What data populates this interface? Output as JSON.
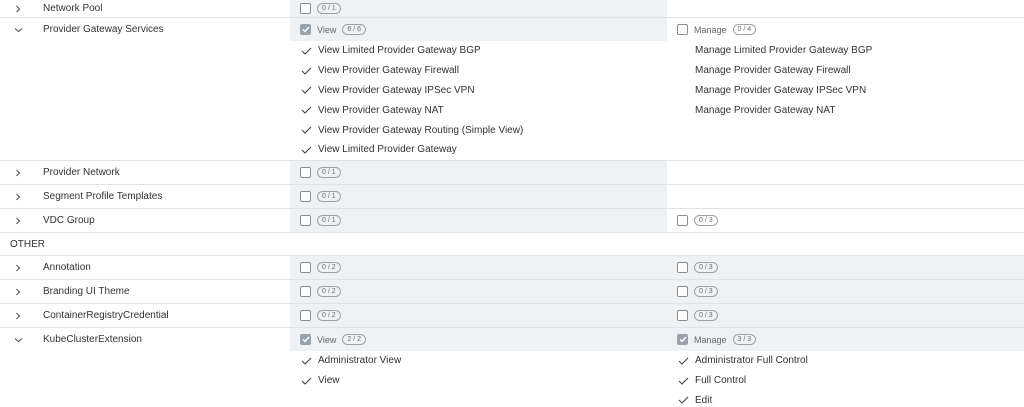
{
  "rows_top": [
    {
      "name": "Network Pool",
      "view_badge": "0 / 1"
    },
    {
      "name": "Provider Gateway Services",
      "view_label": "View",
      "view_badge": "6 / 6",
      "manage_label": "Manage",
      "manage_badge": "0 / 4",
      "view_perms": [
        "View Limited Provider Gateway BGP",
        "View Provider Gateway Firewall",
        "View Provider Gateway IPSec VPN",
        "View Provider Gateway NAT",
        "View Provider Gateway Routing (Simple View)",
        "View Limited Provider Gateway"
      ],
      "manage_perms": [
        "Manage Limited Provider Gateway BGP",
        "Manage Provider Gateway Firewall",
        "Manage Provider Gateway IPSec VPN",
        "Manage Provider Gateway NAT"
      ]
    },
    {
      "name": "Provider Network",
      "view_badge": "0 / 1"
    },
    {
      "name": "Segment Profile Templates",
      "view_badge": "0 / 1"
    },
    {
      "name": "VDC Group",
      "view_badge": "0 / 1",
      "manage_badge": "0 / 3"
    }
  ],
  "section_other": "OTHER",
  "rows_other": [
    {
      "name": "Annotation",
      "view_badge": "0 / 2",
      "manage_badge": "0 / 3"
    },
    {
      "name": "Branding UI Theme",
      "view_badge": "0 / 2",
      "manage_badge": "0 / 3"
    },
    {
      "name": "ContainerRegistryCredential",
      "view_badge": "0 / 2",
      "manage_badge": "0 / 3"
    },
    {
      "name": "KubeClusterExtension",
      "view_label": "View",
      "view_badge": "2 / 2",
      "manage_label": "Manage",
      "manage_badge": "3 / 3",
      "view_perms": [
        "Administrator View",
        "View"
      ],
      "manage_perms": [
        "Administrator Full Control",
        "Full Control",
        "Edit"
      ]
    }
  ],
  "colors": {
    "shade": "#eef2f5",
    "divider": "#e0e2e5",
    "checked": "#9aa3ab"
  },
  "icons": {
    "collapsed": "chevron-right-icon",
    "expanded": "chevron-down-icon",
    "check": "checkmark-icon"
  }
}
